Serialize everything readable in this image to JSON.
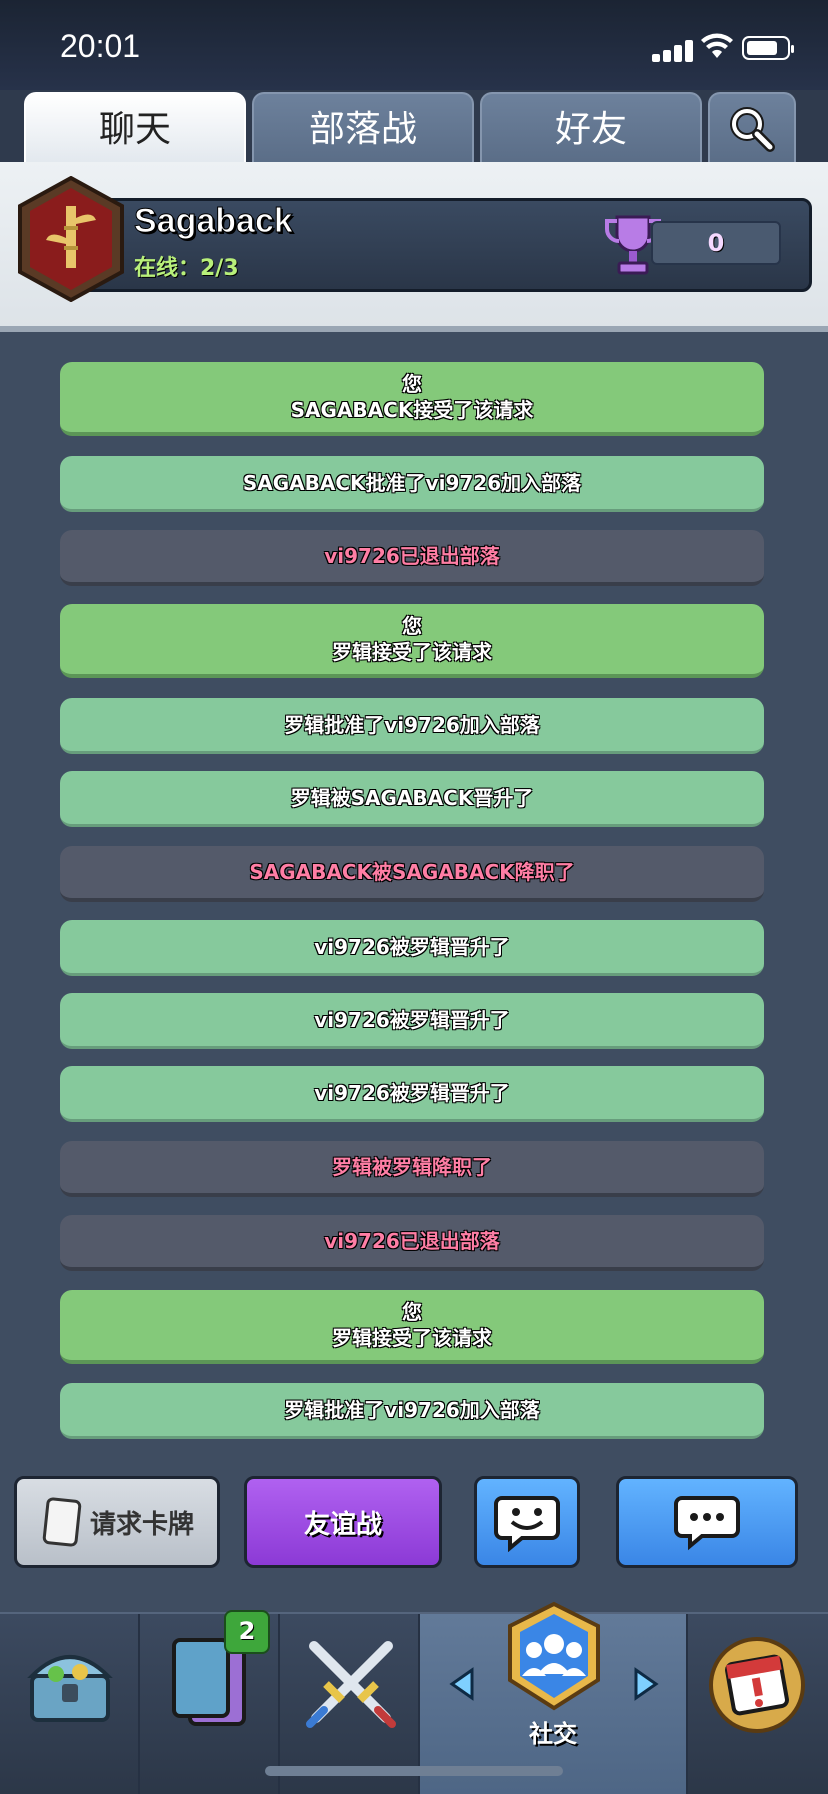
{
  "status": {
    "time": "20:01"
  },
  "tabs": [
    {
      "label": "聊天",
      "active": true
    },
    {
      "label": "部落战",
      "active": false
    },
    {
      "label": "好友",
      "active": false
    }
  ],
  "clan": {
    "name": "Sagaback",
    "online": "在线：2/3",
    "trophies": "0"
  },
  "messages": [
    {
      "type": "accept",
      "line1": "您",
      "line2": "SAGABACK接受了该请求"
    },
    {
      "type": "approve",
      "text": "SAGABACK批准了vi9726加入部落"
    },
    {
      "type": "leave",
      "text": "vi9726已退出部落"
    },
    {
      "type": "accept",
      "line1": "您",
      "line2": "罗辑接受了该请求"
    },
    {
      "type": "approve",
      "text": "罗辑批准了vi9726加入部落"
    },
    {
      "type": "approve",
      "text": "罗辑被SAGABACK晋升了"
    },
    {
      "type": "leave",
      "text": "SAGABACK被SAGABACK降职了"
    },
    {
      "type": "approve",
      "text": "vi9726被罗辑晋升了"
    },
    {
      "type": "approve",
      "text": "vi9726被罗辑晋升了"
    },
    {
      "type": "approve",
      "text": "vi9726被罗辑晋升了"
    },
    {
      "type": "leave",
      "text": "罗辑被罗辑降职了"
    },
    {
      "type": "leave",
      "text": "vi9726已退出部落"
    },
    {
      "type": "accept",
      "line1": "您",
      "line2": "罗辑接受了该请求"
    },
    {
      "type": "approve",
      "text": "罗辑批准了vi9726加入部落"
    }
  ],
  "actions": {
    "request_cards": "请求卡牌",
    "friendly_battle": "友谊战"
  },
  "nav": {
    "social_label": "社交",
    "cards_badge": "2"
  },
  "colors": {
    "accept": "#84c97a",
    "approve": "#86c99c",
    "leave": "#545a6a",
    "leave_text": "#ff7ea5",
    "friendly": "#9b4fe6",
    "chat": "#4a98f0"
  }
}
